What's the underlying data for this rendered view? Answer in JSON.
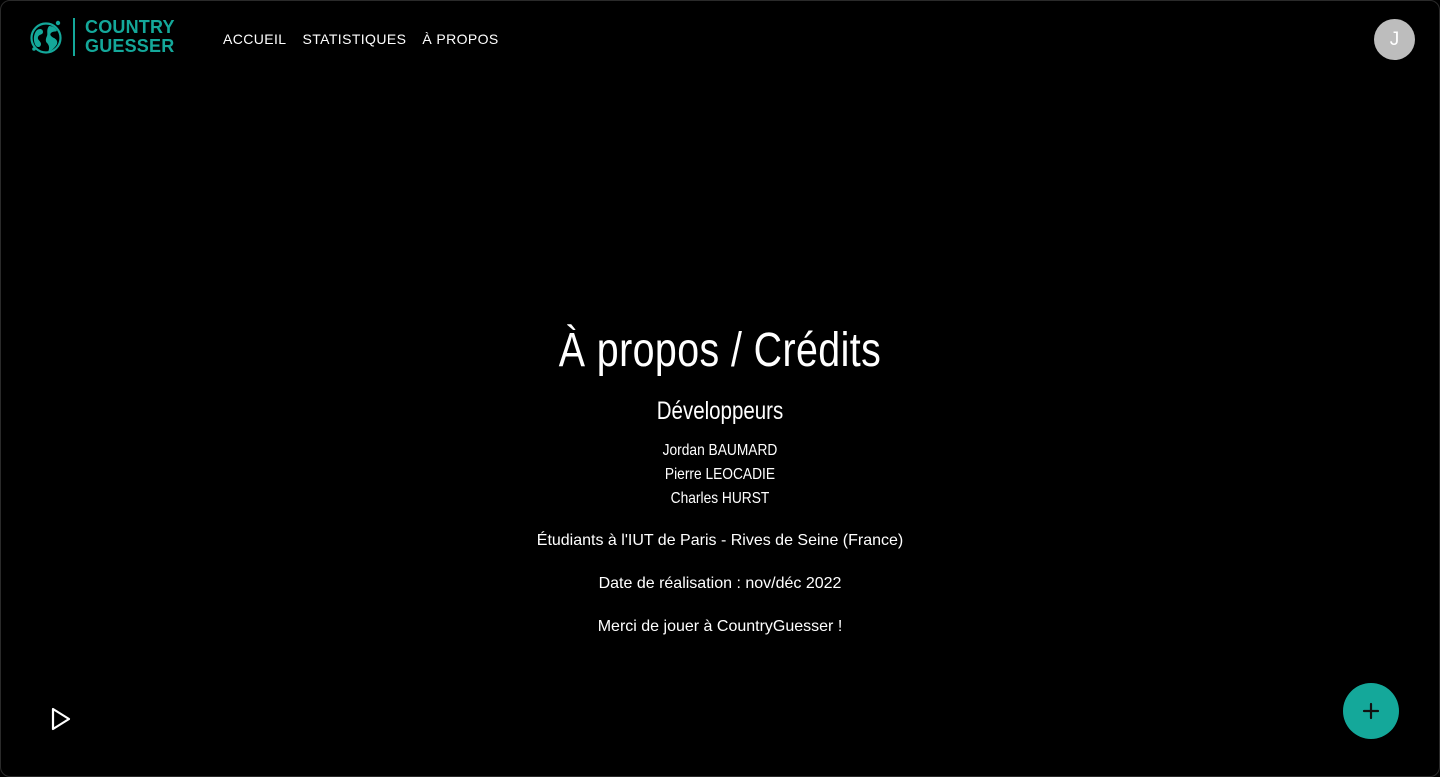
{
  "brand": {
    "line1": "COUNTRY",
    "line2": "GUESSER",
    "logo_icon": "globe-icon",
    "color": "#14a89a"
  },
  "nav": {
    "items": [
      {
        "label": "ACCUEIL"
      },
      {
        "label": "STATISTIQUES"
      },
      {
        "label": "À PROPOS"
      }
    ]
  },
  "user": {
    "avatar_initial": "J"
  },
  "main": {
    "title": "À propos / Crédits",
    "developers_heading": "Développeurs",
    "developers": [
      "Jordan BAUMARD",
      "Pierre LEOCADIE",
      "Charles HURST"
    ],
    "school_line": "Étudiants à l'IUT de Paris - Rives de Seine (France)",
    "date_line": "Date de réalisation : nov/déc 2022",
    "thanks_line": "Merci de jouer à CountryGuesser !"
  },
  "controls": {
    "play_icon": "play-icon",
    "fab_icon": "plus-icon",
    "fab_color": "#14a89a"
  }
}
